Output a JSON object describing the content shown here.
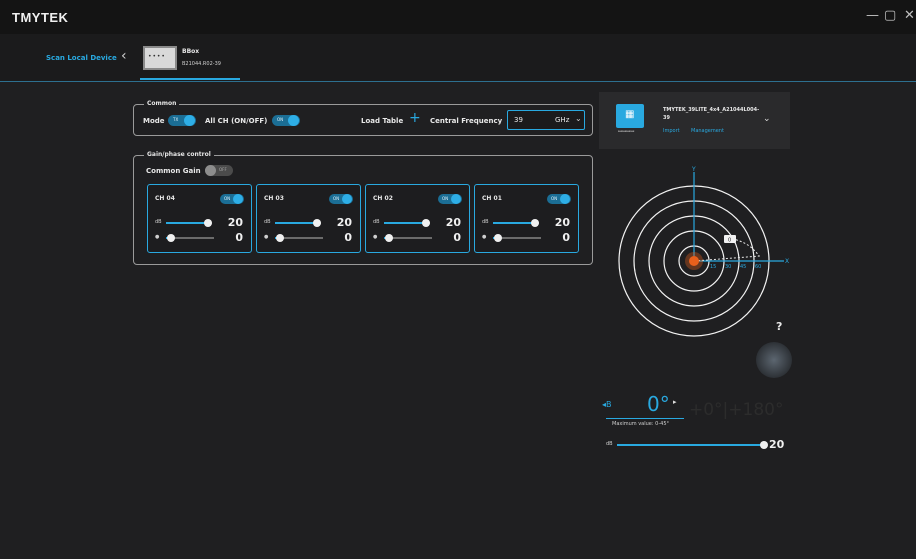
{
  "app": {
    "brand": "TMYTEK"
  },
  "window": {
    "minimize": "—",
    "maximize": "▢",
    "close": "✕"
  },
  "device_bar": {
    "scan_label": "Scan Local Device",
    "back_icon": "chevron-left-icon",
    "tab": {
      "name": "BBox",
      "serial": "B21044.R02-39"
    }
  },
  "common": {
    "legend": "Common",
    "mode_label": "Mode",
    "mode_toggle": "TX",
    "all_ch_label": "All CH (ON/OFF)",
    "all_ch_toggle": "ON",
    "load_table_label": "Load Table",
    "central_frequency_label": "Central Frequency",
    "frequency_value": "39",
    "frequency_unit": "GHz"
  },
  "gain_phase": {
    "legend": "Gain/phase control",
    "common_gain_label": "Common Gain",
    "common_gain_toggle": "OFF",
    "channels": [
      {
        "name": "CH 04",
        "toggle": "ON",
        "gain_icon": "dB",
        "gain": "20",
        "gain_fraction": 0.92,
        "phase_icon": "●",
        "phase": "0",
        "phase_fraction": 0.1
      },
      {
        "name": "CH 03",
        "toggle": "ON",
        "gain_icon": "dB",
        "gain": "20",
        "gain_fraction": 0.92,
        "phase_icon": "●",
        "phase": "0",
        "phase_fraction": 0.1
      },
      {
        "name": "CH 02",
        "toggle": "ON",
        "gain_icon": "dB",
        "gain": "20",
        "gain_fraction": 0.92,
        "phase_icon": "●",
        "phase": "0",
        "phase_fraction": 0.1
      },
      {
        "name": "CH 01",
        "toggle": "ON",
        "gain_icon": "dB",
        "gain": "20",
        "gain_fraction": 0.92,
        "phase_icon": "●",
        "phase": "0",
        "phase_fraction": 0.1
      }
    ]
  },
  "device_card": {
    "title": "TMYTEK_39LITE_4x4_A21044L004-39",
    "import_label": "Import",
    "management_label": "Management",
    "pins": "ꟷꟷꟷꟷ",
    "expand_icon": "chevron-down-icon"
  },
  "polar": {
    "x_axis": "X",
    "y_axis": "Y",
    "ring_labels": [
      "15",
      "30",
      "45",
      "60"
    ],
    "marker_label": "0",
    "marker_color": "#e8601c"
  },
  "beam": {
    "help": "?",
    "mode": "B",
    "angle": "0°",
    "max_note": "Maximum value: 0-45°",
    "ghost_values": "+0°|+180°",
    "gain_icon": "dB",
    "gain": "20",
    "gain_fraction": 1.0
  },
  "colors": {
    "accent": "#29a9e0",
    "background": "#1f1f21"
  }
}
